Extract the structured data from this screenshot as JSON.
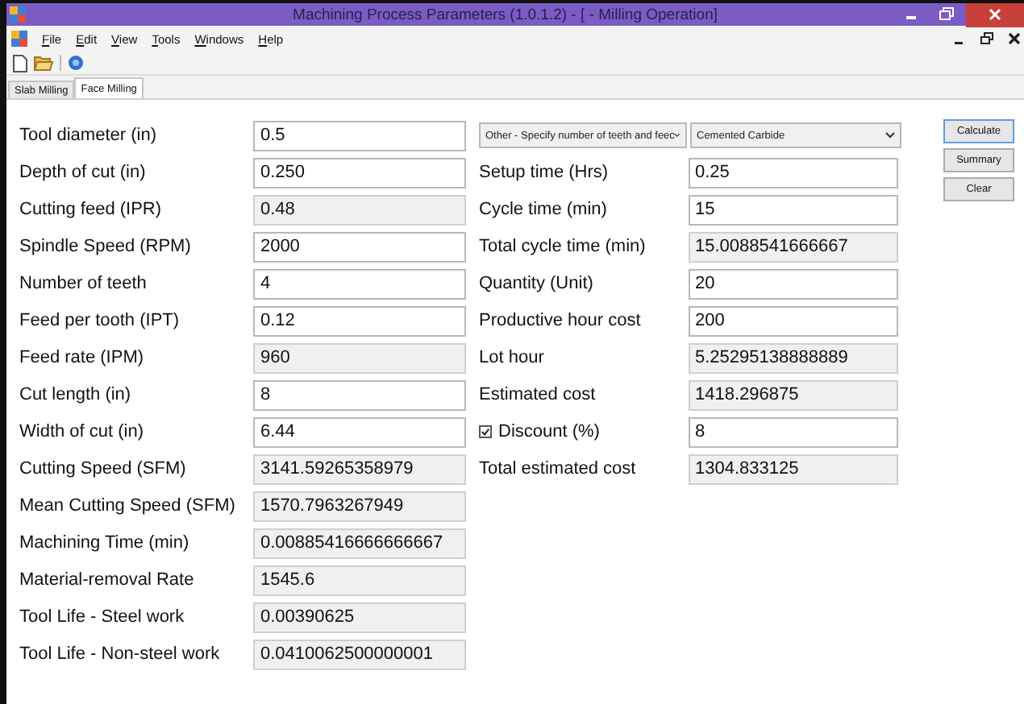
{
  "window": {
    "title": "Machining Process Parameters (1.0.1.2) - [ - Milling Operation]"
  },
  "menu": [
    "File",
    "Edit",
    "View",
    "Tools",
    "Windows",
    "Help"
  ],
  "tabs": [
    {
      "label": "Slab Milling",
      "selected": false
    },
    {
      "label": "Face Milling",
      "selected": true
    }
  ],
  "left_fields": [
    {
      "label": "Tool diameter (in)",
      "value": "0.5",
      "readonly": false
    },
    {
      "label": "Depth of cut (in)",
      "value": "0.250",
      "readonly": false
    },
    {
      "label": "Cutting feed (IPR)",
      "value": "0.48",
      "readonly": true
    },
    {
      "label": "Spindle Speed (RPM)",
      "value": "2000",
      "readonly": false
    },
    {
      "label": "Number of teeth",
      "value": "4",
      "readonly": false
    },
    {
      "label": "Feed per tooth (IPT)",
      "value": "0.12",
      "readonly": false
    },
    {
      "label": "Feed rate (IPM)",
      "value": "960",
      "readonly": true
    },
    {
      "label": "Cut length (in)",
      "value": "8",
      "readonly": false
    },
    {
      "label": "Width of cut (in)",
      "value": "6.44",
      "readonly": false
    },
    {
      "label": "Cutting Speed (SFM)",
      "value": "3141.59265358979",
      "readonly": true
    },
    {
      "label": "Mean Cutting Speed (SFM)",
      "value": "1570.7963267949",
      "readonly": true
    },
    {
      "label": "Machining Time (min)",
      "value": "0.00885416666666667",
      "readonly": true
    },
    {
      "label": "Material-removal Rate",
      "value": "1545.6",
      "readonly": true
    },
    {
      "label": "Tool Life - Steel work",
      "value": "0.00390625",
      "readonly": true
    },
    {
      "label": "Tool Life - Non-steel work",
      "value": "0.0410062500000001",
      "readonly": true
    }
  ],
  "dropdowns": [
    {
      "value": "Other - Specify number of teeth and feec"
    },
    {
      "value": "Cemented Carbide"
    }
  ],
  "right_fields": [
    {
      "kind": "field",
      "label": "Setup time (Hrs)",
      "value": "0.25",
      "readonly": false
    },
    {
      "kind": "field",
      "label": "Cycle time (min)",
      "value": "15",
      "readonly": false
    },
    {
      "kind": "field",
      "label": "Total cycle time (min)",
      "value": "15.0088541666667",
      "readonly": true
    },
    {
      "kind": "field",
      "label": "Quantity (Unit)",
      "value": "20",
      "readonly": false
    },
    {
      "kind": "field",
      "label": "Productive hour cost",
      "value": "200",
      "readonly": false
    },
    {
      "kind": "field",
      "label": "Lot hour",
      "value": "5.25295138888889",
      "readonly": true
    },
    {
      "kind": "field",
      "label": "Estimated cost",
      "value": "1418.296875",
      "readonly": true
    },
    {
      "kind": "checkbox",
      "label": "Discount (%)",
      "checked": true,
      "value": "8",
      "readonly": false
    },
    {
      "kind": "field",
      "label": "Total estimated cost",
      "value": "1304.833125",
      "readonly": true
    }
  ],
  "buttons": [
    "Calculate",
    "Summary",
    "Clear"
  ]
}
